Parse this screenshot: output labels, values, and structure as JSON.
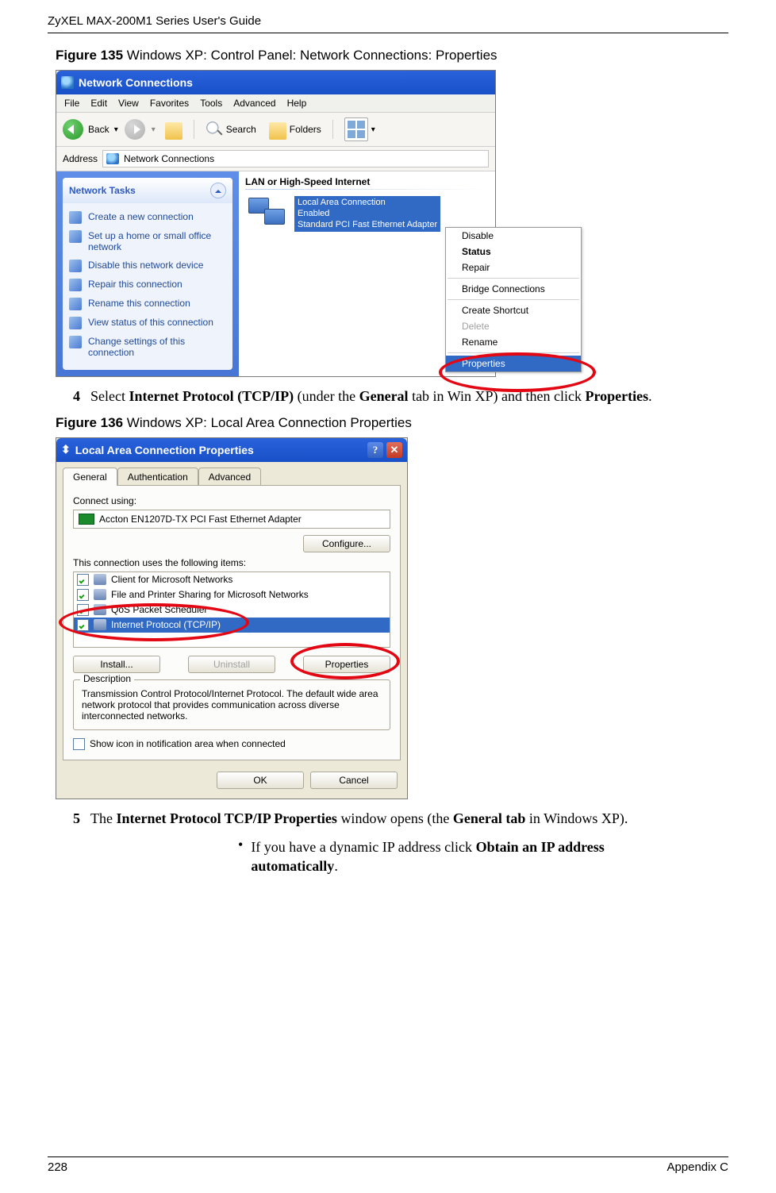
{
  "header": {
    "running_head": "ZyXEL MAX-200M1 Series User's Guide"
  },
  "footer": {
    "page_number": "228",
    "section": "Appendix C"
  },
  "fig135": {
    "label_strong": "Figure 135",
    "label_rest": "   Windows XP: Control Panel: Network Connections: Properties",
    "window_title": "Network Connections",
    "menu": [
      "File",
      "Edit",
      "View",
      "Favorites",
      "Tools",
      "Advanced",
      "Help"
    ],
    "toolbar": {
      "back": "Back",
      "search": "Search",
      "folders": "Folders"
    },
    "address_label": "Address",
    "address_value": "Network Connections",
    "tasks_header": "Network Tasks",
    "tasks": [
      "Create a new connection",
      "Set up a home or small office network",
      "Disable this network device",
      "Repair this connection",
      "Rename this connection",
      "View status of this connection",
      "Change settings of this connection"
    ],
    "group_header": "LAN or High-Speed Internet",
    "nic": {
      "name": "Local Area Connection",
      "status": "Enabled",
      "device": "Standard PCI Fast Ethernet Adapter"
    },
    "context_menu": {
      "disable": "Disable",
      "status": "Status",
      "repair": "Repair",
      "bridge": "Bridge Connections",
      "shortcut": "Create Shortcut",
      "delete": "Delete",
      "rename": "Rename",
      "properties": "Properties"
    }
  },
  "step4": {
    "num": "4",
    "t1": "Select ",
    "b1": "Internet Protocol (TCP/IP)",
    "t2": " (under the ",
    "b2": "General",
    "t3": " tab in Win XP) and then click ",
    "b3": "Properties",
    "t4": "."
  },
  "fig136": {
    "label_strong": "Figure 136",
    "label_rest": "   Windows XP: Local Area Connection Properties",
    "window_title": "Local Area Connection Properties",
    "help_glyph": "?",
    "close_glyph": "✕",
    "tabs": {
      "general": "General",
      "auth": "Authentication",
      "adv": "Advanced"
    },
    "connect_using": "Connect using:",
    "device_name": "Accton EN1207D-TX PCI Fast Ethernet Adapter",
    "configure": "Configure...",
    "items_label": "This connection uses the following items:",
    "items": [
      "Client for Microsoft Networks",
      "File and Printer Sharing for Microsoft Networks",
      "QoS Packet Scheduler",
      "Internet Protocol (TCP/IP)"
    ],
    "install": "Install...",
    "uninstall": "Uninstall",
    "properties": "Properties",
    "desc_legend": "Description",
    "desc_text": "Transmission Control Protocol/Internet Protocol. The default wide area network protocol that provides communication across diverse interconnected networks.",
    "show_icon": "Show icon in notification area when connected",
    "ok": "OK",
    "cancel": "Cancel"
  },
  "step5": {
    "num": "5",
    "t1": "The ",
    "b1": "Internet Protocol TCP/IP Properties",
    "t2": " window opens (the ",
    "b2": "General tab",
    "t3": " in Windows XP)."
  },
  "sub_bullet": {
    "dot": "•",
    "t1": "If you have a dynamic IP address click ",
    "b1": "Obtain an IP address automatically",
    "t2": "."
  }
}
